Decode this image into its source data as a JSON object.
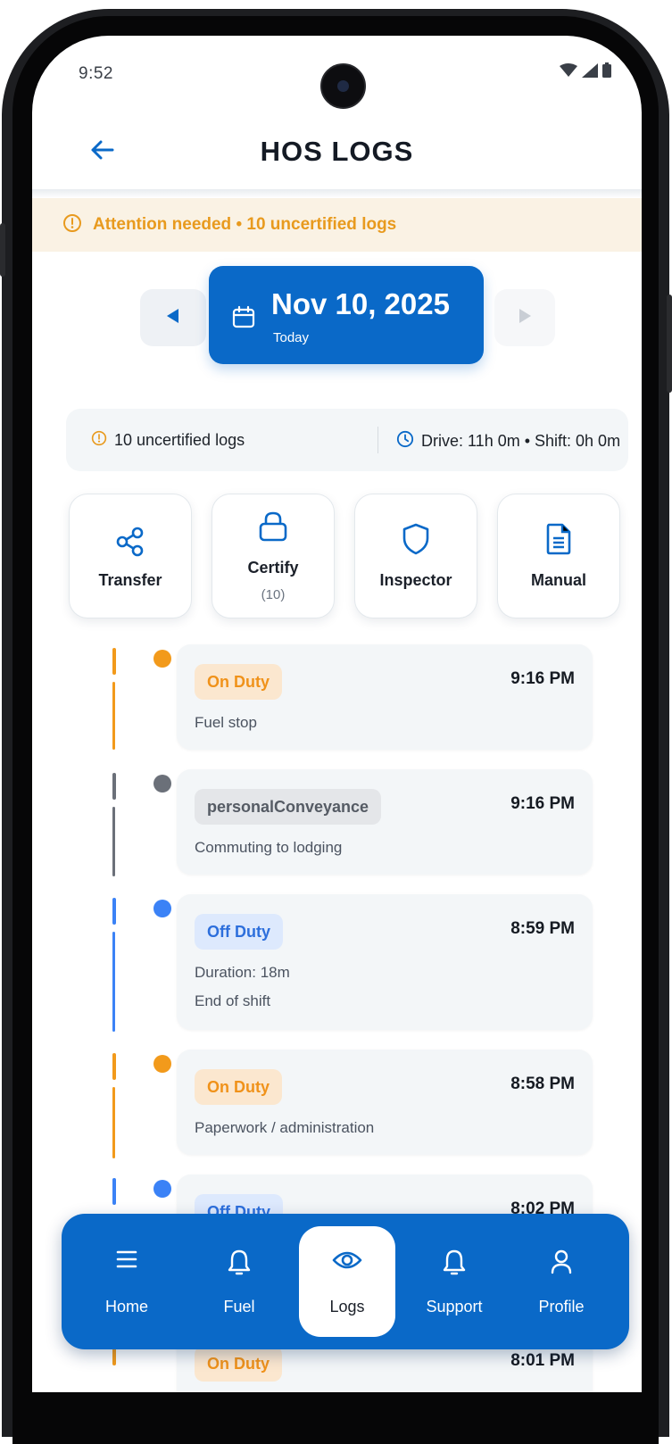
{
  "status_bar": {
    "time": "9:52"
  },
  "header": {
    "title": "HOS LOGS",
    "back_icon": "arrow-left-icon"
  },
  "attention": {
    "text": "Attention needed • 10 uncertified logs",
    "color": "#E89A1E"
  },
  "date_nav": {
    "date": "Nov 10, 2025",
    "subtitle": "Today"
  },
  "summary": {
    "uncertified": "10 uncertified logs",
    "hours": "Drive: 11h 0m • Shift: 0h 0m"
  },
  "actions": [
    {
      "label": "Transfer",
      "icon": "share-icon"
    },
    {
      "label": "Certify",
      "count": "(10)",
      "icon": "lock-icon"
    },
    {
      "label": "Inspector",
      "icon": "shield-icon"
    },
    {
      "label": "Manual",
      "icon": "document-icon"
    }
  ],
  "logs": [
    {
      "status": "On Duty",
      "time": "9:16 PM",
      "notes": [
        "Fuel stop"
      ],
      "color": "#F29A1B"
    },
    {
      "status": "personalConveyance",
      "time": "9:16 PM",
      "notes": [
        "Commuting to lodging"
      ],
      "color": "#6B7079"
    },
    {
      "status": "Off Duty",
      "time": "8:59 PM",
      "notes": [
        "Duration: 18m",
        "End of shift"
      ],
      "color": "#3B82F6"
    },
    {
      "status": "On Duty",
      "time": "8:58 PM",
      "notes": [
        "Paperwork / administration"
      ],
      "color": "#F29A1B"
    },
    {
      "status": "Off Duty",
      "time": "8:02 PM",
      "notes": [],
      "color": "#3B82F6"
    },
    {
      "status": "On Duty",
      "time": "8:01 PM",
      "notes": [],
      "color": "#F29A1B"
    }
  ],
  "nav": {
    "items": [
      {
        "label": "Home",
        "icon": "menu-icon"
      },
      {
        "label": "Fuel",
        "icon": "bell-icon"
      },
      {
        "label": "Logs",
        "icon": "eye-icon",
        "active": true
      },
      {
        "label": "Support",
        "icon": "bell-icon"
      },
      {
        "label": "Profile",
        "icon": "user-icon"
      }
    ],
    "color": "#0A69C8"
  }
}
